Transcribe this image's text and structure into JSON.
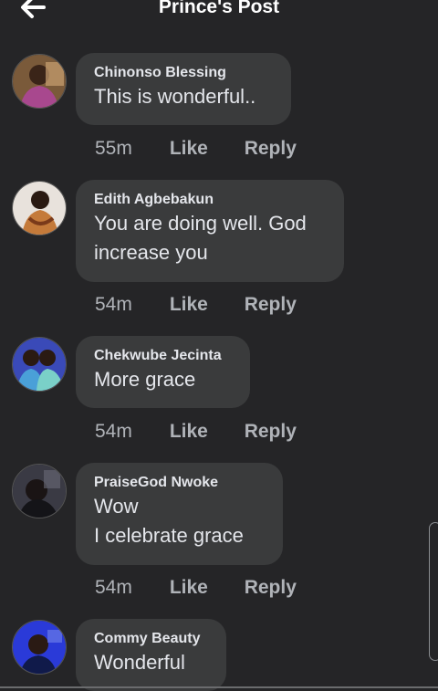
{
  "header": {
    "title": "Prince's Post"
  },
  "actions": {
    "like_label": "Like",
    "reply_label": "Reply"
  },
  "comments": [
    {
      "author": "Chinonso Blessing",
      "text": "This is wonderful..",
      "time": "55m"
    },
    {
      "author": "Edith Agbebakun",
      "text": "You are doing well. God\nincrease you",
      "time": "54m"
    },
    {
      "author": "Chekwube Jecinta",
      "text": "More grace",
      "time": "54m"
    },
    {
      "author": "PraiseGod Nwoke",
      "text": "Wow\nI celebrate grace",
      "time": "54m"
    },
    {
      "author": "Commy Beauty",
      "text": "Wonderful",
      "time": ""
    }
  ],
  "colors": {
    "background": "#252527",
    "bubble": "#3a3b3c",
    "meta_text": "#b0b3b8",
    "text": "#e4e6eb"
  }
}
